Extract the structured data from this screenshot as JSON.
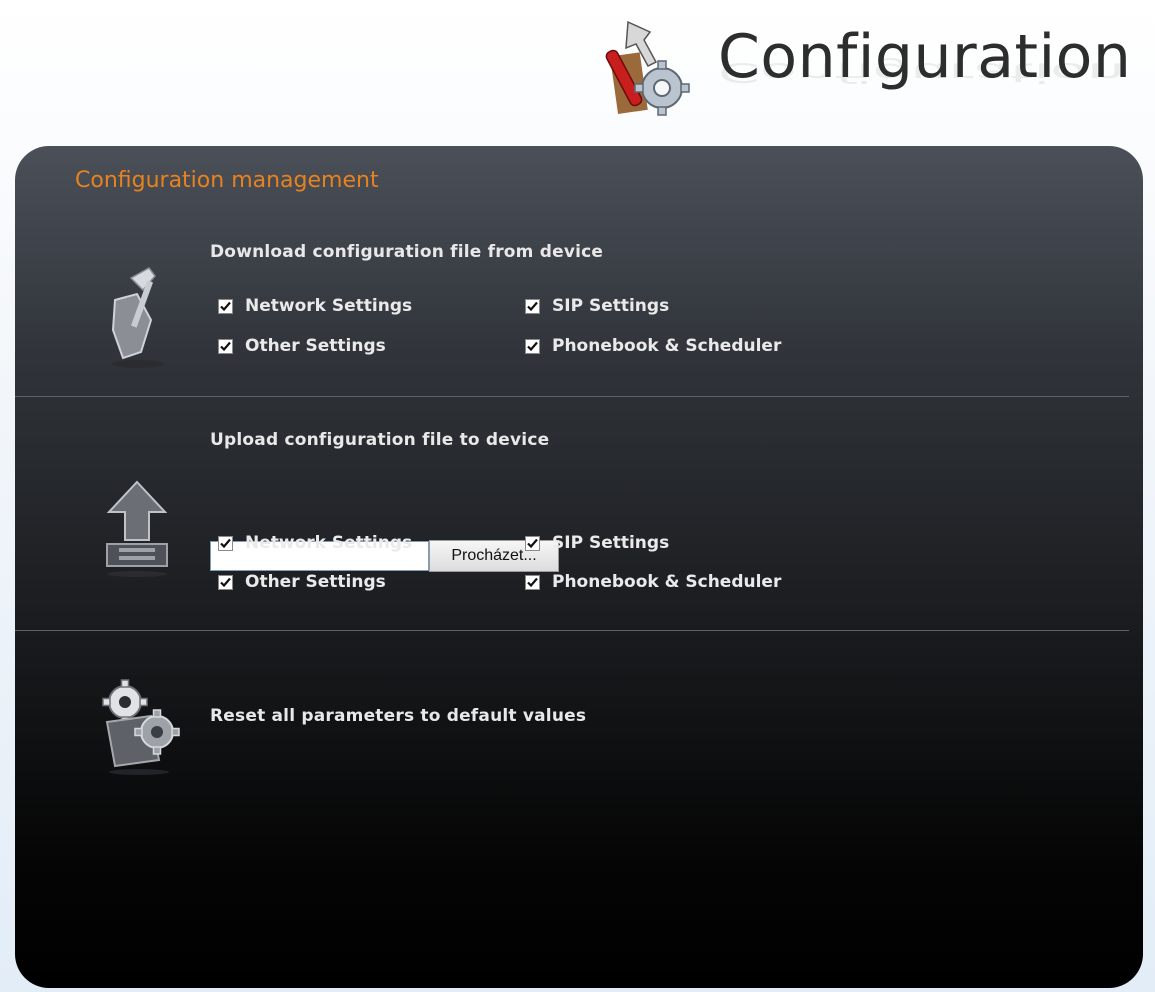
{
  "header": {
    "title": "Configuration",
    "logo_icon": "tools-gear-icon"
  },
  "panel": {
    "title": "Configuration management",
    "title_color": "#e8821e"
  },
  "download": {
    "heading": "Download configuration file from device",
    "icon": "download-tool-icon",
    "checkboxes": [
      {
        "label": "Network Settings",
        "checked": true
      },
      {
        "label": "SIP Settings",
        "checked": true
      },
      {
        "label": "Other Settings",
        "checked": true
      },
      {
        "label": "Phonebook & Scheduler",
        "checked": true
      }
    ]
  },
  "upload": {
    "heading": "Upload configuration file to device",
    "icon": "upload-arrow-icon",
    "file_value": "",
    "browse_label": "Procházet...",
    "checkboxes": [
      {
        "label": "Network Settings",
        "checked": true
      },
      {
        "label": "SIP Settings",
        "checked": true
      },
      {
        "label": "Other Settings",
        "checked": true
      },
      {
        "label": "Phonebook & Scheduler",
        "checked": true
      }
    ]
  },
  "reset": {
    "label": "Reset all parameters to default values",
    "icon": "reset-gears-icon"
  }
}
